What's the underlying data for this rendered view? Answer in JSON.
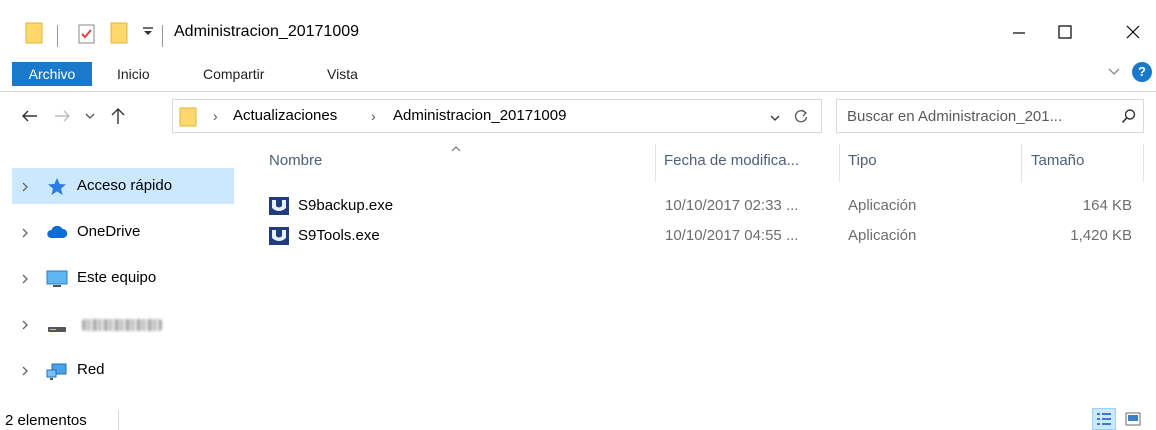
{
  "window": {
    "title": "Administracion_20171009"
  },
  "ribbon": {
    "tabs": [
      {
        "label": "Archivo",
        "active": true
      },
      {
        "label": "Inicio"
      },
      {
        "label": "Compartir"
      },
      {
        "label": "Vista"
      }
    ],
    "help_label": "?"
  },
  "address": {
    "crumbs": [
      "Actualizaciones",
      "Administracion_20171009"
    ],
    "separator": "›"
  },
  "search": {
    "placeholder": "Buscar en Administracion_201..."
  },
  "nav_pane": {
    "items": [
      {
        "label": "Acceso rápido",
        "icon": "star-pin-icon",
        "selected": true
      },
      {
        "label": "OneDrive",
        "icon": "cloud-icon"
      },
      {
        "label": "Este equipo",
        "icon": "computer-icon"
      },
      {
        "label": "",
        "icon": "drive-icon",
        "blurred": true
      },
      {
        "label": "Red",
        "icon": "network-icon"
      }
    ]
  },
  "columns": {
    "name": "Nombre",
    "date": "Fecha de modifica...",
    "type": "Tipo",
    "size": "Tamaño"
  },
  "files": [
    {
      "name": "S9backup.exe",
      "date": "10/10/2017 02:33 ...",
      "type": "Aplicación",
      "size": "164 KB"
    },
    {
      "name": "S9Tools.exe",
      "date": "10/10/2017 04:55 ...",
      "type": "Aplicación",
      "size": "1,420 KB"
    }
  ],
  "status": {
    "count_text": "2 elementos"
  },
  "colors": {
    "accent": "#1979ca",
    "selection": "#cce8ff",
    "folder": "#ffd86c",
    "header_text": "#4c607a"
  }
}
